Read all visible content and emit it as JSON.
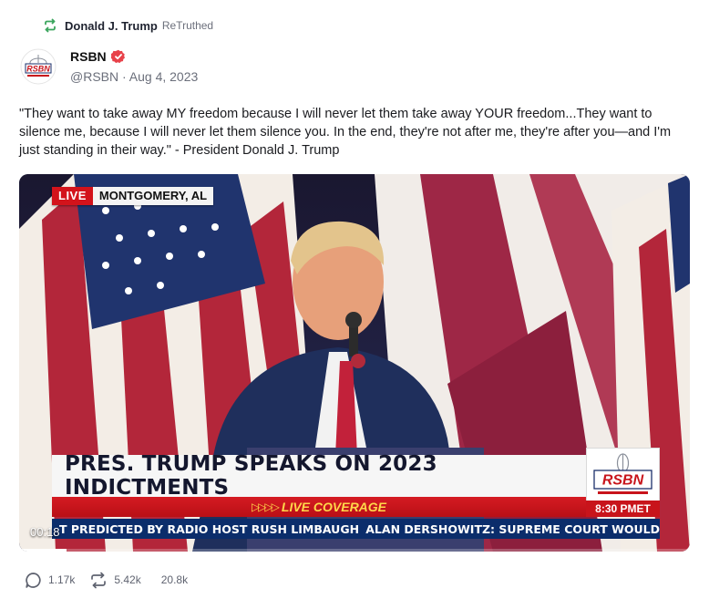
{
  "retruth": {
    "name": "Donald J. Trump",
    "label": "ReTruthed",
    "icon": "retruth-icon",
    "color": "#3ba55d"
  },
  "author": {
    "name": "RSBN",
    "verified_icon": "verified-badge-icon",
    "verified_color": "#e8424a",
    "handle_date": "@RSBN · Aug 4, 2023",
    "avatar_logo_text": "RSBN"
  },
  "post": {
    "text": "\"They want to take away MY freedom because I will never let them take away YOUR freedom...They want to silence me, because I will never let them silence you. In the end, they're not after me, they're after you—and I'm just standing in their way.\" - President Donald J. Trump"
  },
  "video": {
    "live_label": "LIVE",
    "location": "MONTGOMERY, AL",
    "headline": "PRES. TRUMP SPEAKS ON 2023 INDICTMENTS",
    "coverage_label": "LIVE COVERAGE",
    "logo_text": "RSBN",
    "logo_time": "8:30 PMET",
    "ticker_left": "T PREDICTED BY RADIO HOST RUSH LIMBAUGH",
    "ticker_right": "ALAN DERSHOWITZ: SUPREME COURT WOULD",
    "timestamp": "00:18",
    "progress": 0.07
  },
  "actions": {
    "replies": "1.17k",
    "retruths": "5.42k",
    "likes": "20.8k",
    "reply_icon": "reply-icon",
    "retruth_icon": "retruth-icon"
  },
  "colors": {
    "accent_red": "#d3131b",
    "ticker_blue": "#0b2d6b",
    "muted_text": "#6b6f7b"
  }
}
